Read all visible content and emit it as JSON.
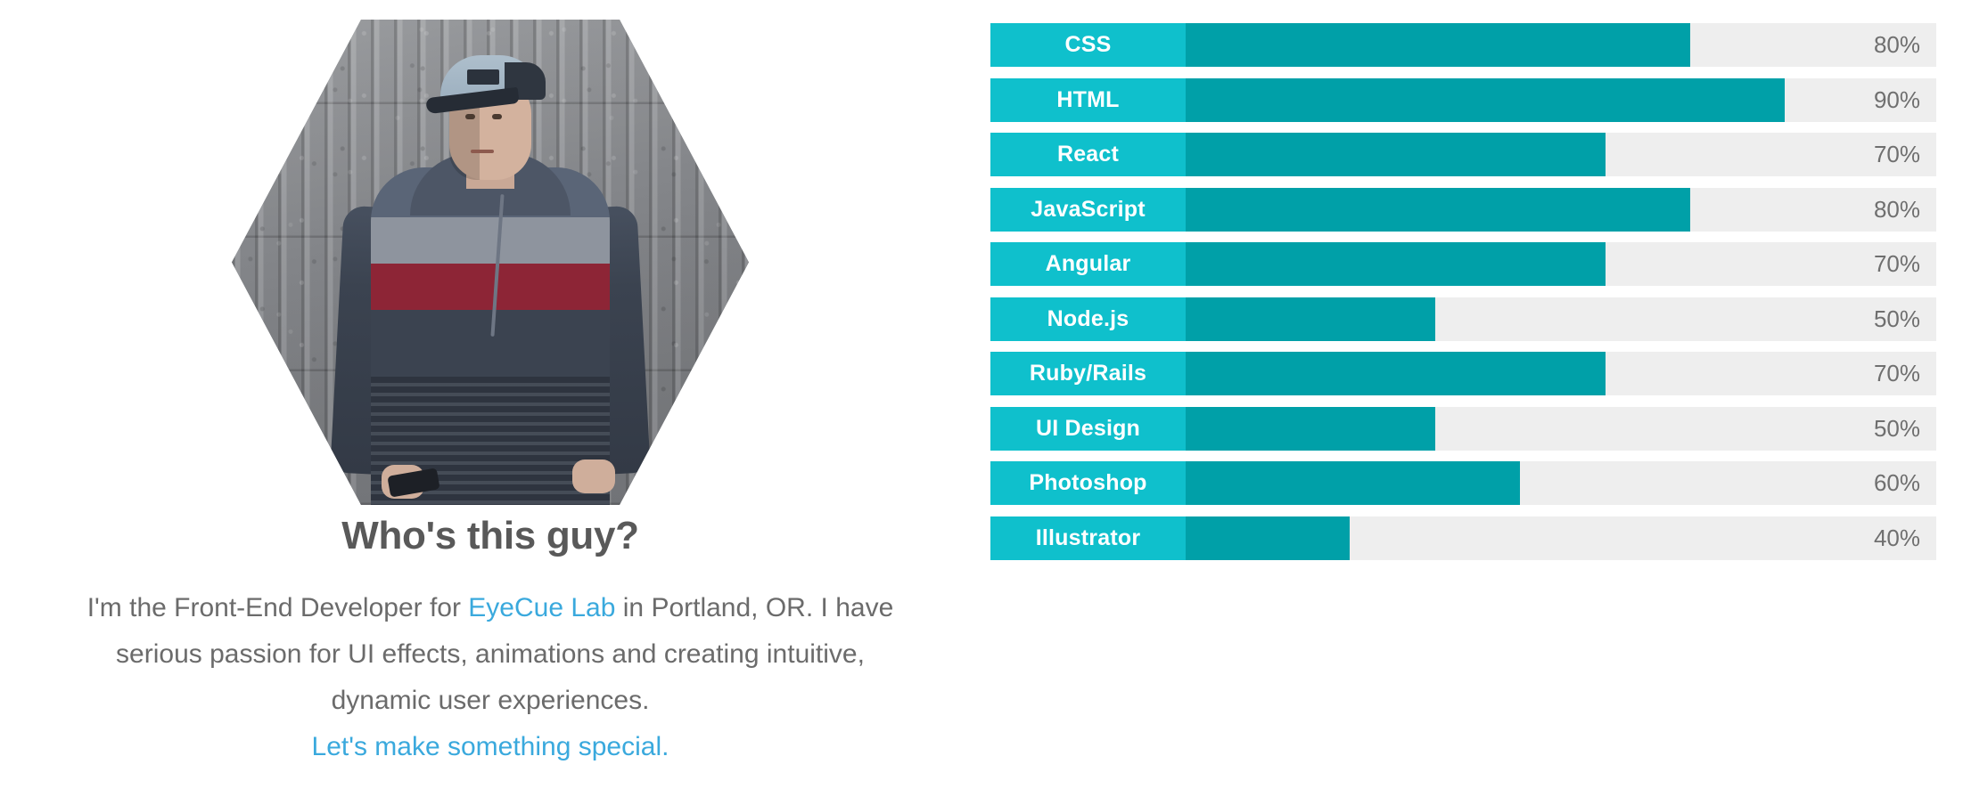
{
  "profile": {
    "photo_alt": "portrait-photo-hexagon",
    "heading": "Who's this guy?",
    "bio": {
      "line1_before_link": "I'm the Front-End Developer for ",
      "company_link": "EyeCue Lab",
      "line1_after_link": " in Portland, OR.",
      "line2": "I have serious passion for UI effects, animations and creating",
      "line3": "intuitive, dynamic user experiences.",
      "cta_link": "Let's make something special."
    }
  },
  "colors": {
    "label_teal": "#0fc0cc",
    "fill_teal": "#00a0a8",
    "track_gray": "#eeeeee",
    "link_blue": "#3aa9dd",
    "heading_gray": "#595959",
    "body_gray": "#6b6b6b",
    "pct_gray": "#6f6f6f"
  },
  "chart_data": {
    "type": "bar",
    "title": "",
    "xlabel": "",
    "ylabel": "",
    "orientation": "horizontal",
    "grid": false,
    "legend": null,
    "xlim": [
      0,
      100
    ],
    "value_suffix": "%",
    "categories": [
      "CSS",
      "HTML",
      "React",
      "JavaScript",
      "Angular",
      "Node.js",
      "Ruby/Rails",
      "UI Design",
      "Photoshop",
      "Illustrator"
    ],
    "values": [
      80,
      90,
      70,
      80,
      70,
      50,
      70,
      50,
      60,
      40
    ],
    "bars": [
      {
        "label": "CSS",
        "value": 80,
        "value_text": "80%",
        "fill_ratio": 74
      },
      {
        "label": "HTML",
        "value": 90,
        "value_text": "90%",
        "fill_ratio": 84
      },
      {
        "label": "React",
        "value": 70,
        "value_text": "70%",
        "fill_ratio": 65
      },
      {
        "label": "JavaScript",
        "value": 80,
        "value_text": "80%",
        "fill_ratio": 74
      },
      {
        "label": "Angular",
        "value": 70,
        "value_text": "70%",
        "fill_ratio": 65
      },
      {
        "label": "Node.js",
        "value": 50,
        "value_text": "50%",
        "fill_ratio": 47
      },
      {
        "label": "Ruby/Rails",
        "value": 70,
        "value_text": "70%",
        "fill_ratio": 65
      },
      {
        "label": "UI Design",
        "value": 50,
        "value_text": "50%",
        "fill_ratio": 47
      },
      {
        "label": "Photoshop",
        "value": 60,
        "value_text": "60%",
        "fill_ratio": 56
      },
      {
        "label": "Illustrator",
        "value": 40,
        "value_text": "40%",
        "fill_ratio": 38
      }
    ]
  }
}
